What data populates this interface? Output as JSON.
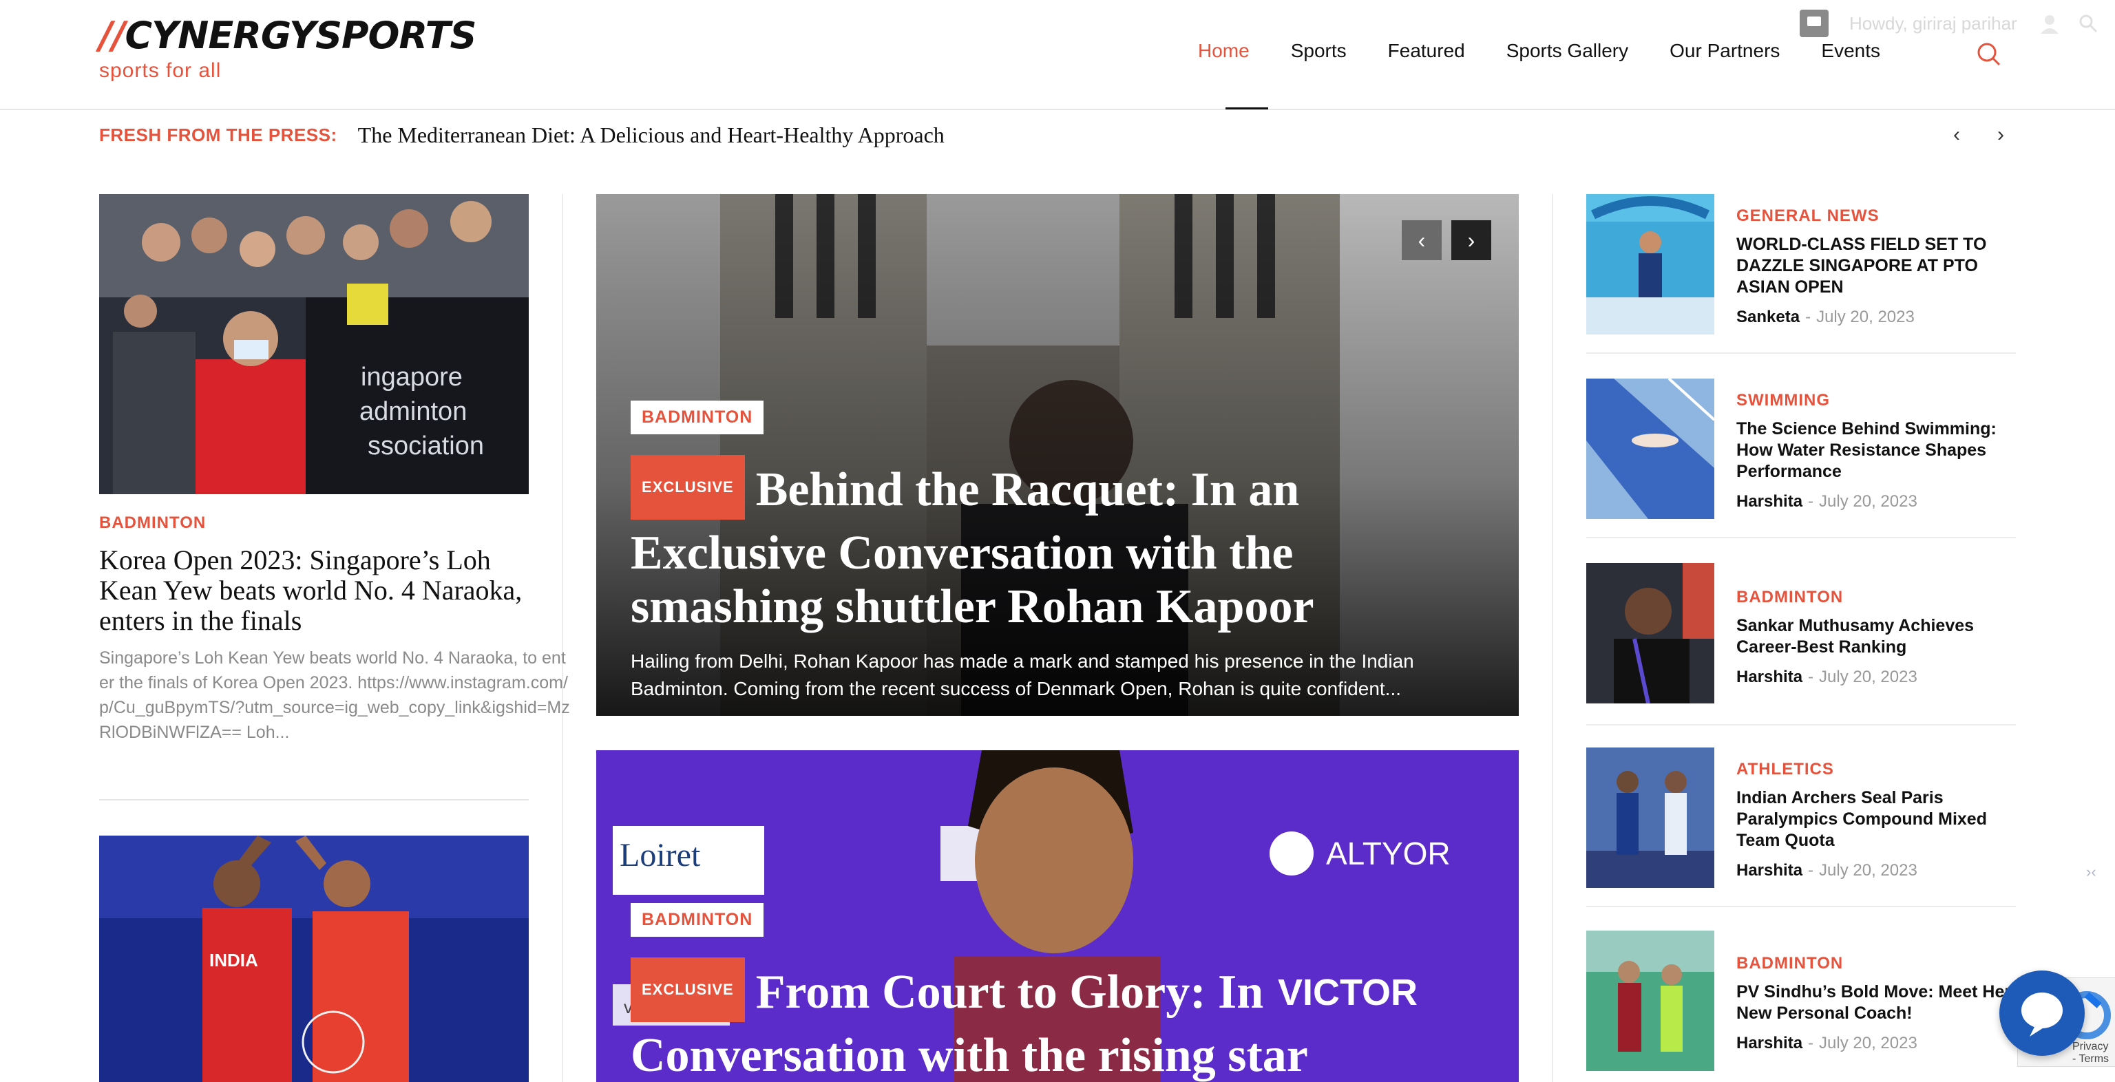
{
  "header": {
    "logo_prefix": "//",
    "logo_name": "CYNERGYSPORTS",
    "tagline": "sports for all",
    "nav": [
      "Home",
      "Sports",
      "Featured",
      "Sports Gallery",
      "Our Partners",
      "Events"
    ],
    "active_nav": "Home",
    "admin_greeting": "Howdy, giriraj parihar"
  },
  "ticker": {
    "label": "FRESH FROM THE PRESS:",
    "headline": "The Mediterranean Diet: A Delicious and Heart-Healthy Approach"
  },
  "left": {
    "card1": {
      "category": "BADMINTON",
      "title": "Korea Open 2023: Singapore’s Loh Kean Yew beats world No. 4 Naraoka, enters in the finals",
      "excerpt": "Singapore’s Loh Kean Yew beats world No. 4 Naraoka, to enter the finals of Korea Open 2023. https://www.instagram.com/p/Cu_guBpymTS/?utm_source=ig_web_copy_link&igshid=MzRlODBiNWFlZA== Loh...",
      "image_text": [
        "ingapore",
        "adminton",
        "ssociation"
      ]
    },
    "card2": {
      "image_text": "INDIA"
    }
  },
  "center": {
    "hero1": {
      "category": "BADMINTON",
      "badge": "EXCLUSIVE",
      "title": "Behind the Racquet: In an Exclusive Conversation with the smashing shuttler Rohan Kapoor",
      "excerpt": "Hailing from Delhi, Rohan Kapoor has made a mark and stamped his presence in the Indian Badminton. Coming from the recent success of Denmark Open, Rohan is quite confident..."
    },
    "hero2": {
      "category": "BADMINTON",
      "badge": "EXCLUSIVE",
      "title": "From Court to Glory: In Conversation with the rising star",
      "sponsor_texts": [
        "Loiret",
        "ALTYOR",
        "VICTOR",
        "vibration"
      ]
    }
  },
  "sidebar": [
    {
      "category": "GENERAL NEWS",
      "title": "WORLD-CLASS FIELD SET TO DAZZLE SINGAPORE AT PTO ASIAN OPEN",
      "author": "Sanketa",
      "date": "July 20, 2023"
    },
    {
      "category": "SWIMMING",
      "title": "The Science Behind Swimming: How Water Resistance Shapes Performance",
      "author": "Harshita",
      "date": "July 20, 2023"
    },
    {
      "category": "BADMINTON",
      "title": "Sankar Muthusamy Achieves Career-Best Ranking",
      "author": "Harshita",
      "date": "July 20, 2023"
    },
    {
      "category": "ATHLETICS",
      "title": "Indian Archers Seal Paris Paralympics Compound Mixed Team Quota",
      "author": "Harshita",
      "date": "July 20, 2023"
    },
    {
      "category": "BADMINTON",
      "title": "PV Sindhu’s Bold Move: Meet Her New Personal Coach!",
      "author": "Harshita",
      "date": "July 20, 2023"
    }
  ],
  "meta_separator": "-",
  "recaptcha": "Privacy - Terms",
  "icons": {
    "search": "search-icon",
    "chat": "chat-bubble-icon",
    "prev": "chevron-left-icon",
    "next": "chevron-right-icon"
  },
  "colors": {
    "accent": "#e5533d",
    "chat": "#1e5bb8"
  }
}
